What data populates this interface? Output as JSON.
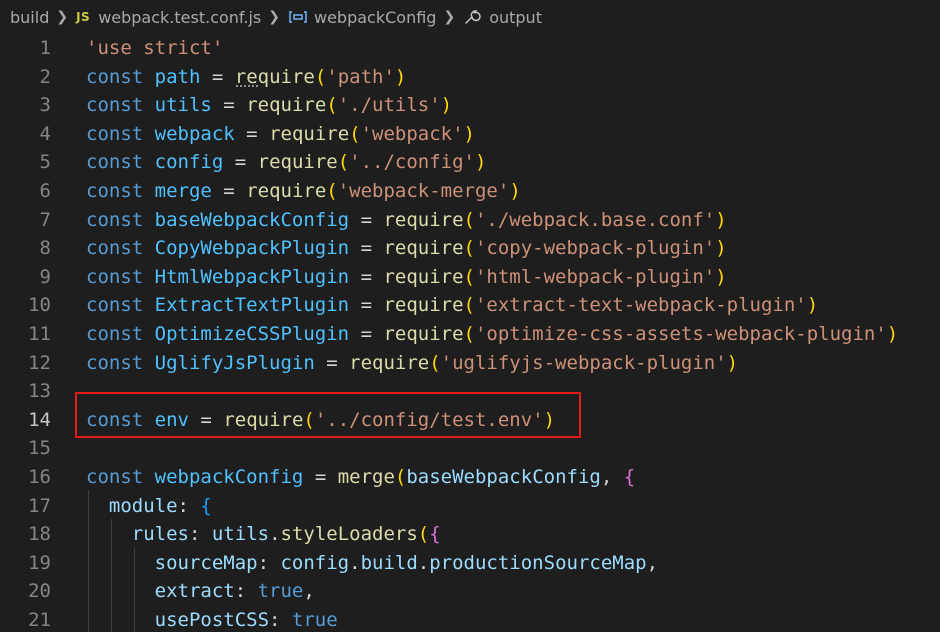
{
  "breadcrumb": {
    "folder": "build",
    "js_badge": "JS",
    "file": "webpack.test.conf.js",
    "symbol": "webpackConfig",
    "property": "output"
  },
  "code_lines": [
    {
      "n": "1",
      "tokens": [
        [
          "s",
          "'use strict'"
        ]
      ]
    },
    {
      "n": "2",
      "tokens": [
        [
          "k",
          "const"
        ],
        [
          "o",
          " "
        ],
        [
          "v",
          "path"
        ],
        [
          "o",
          " = "
        ],
        [
          "f",
          "require"
        ],
        [
          "br1",
          "("
        ],
        [
          "s",
          "'path'"
        ],
        [
          "br1",
          ")"
        ]
      ]
    },
    {
      "n": "3",
      "tokens": [
        [
          "k",
          "const"
        ],
        [
          "o",
          " "
        ],
        [
          "v",
          "utils"
        ],
        [
          "o",
          " = "
        ],
        [
          "f",
          "require"
        ],
        [
          "br1",
          "("
        ],
        [
          "s",
          "'./utils'"
        ],
        [
          "br1",
          ")"
        ]
      ]
    },
    {
      "n": "4",
      "tokens": [
        [
          "k",
          "const"
        ],
        [
          "o",
          " "
        ],
        [
          "v",
          "webpack"
        ],
        [
          "o",
          " = "
        ],
        [
          "f",
          "require"
        ],
        [
          "br1",
          "("
        ],
        [
          "s",
          "'webpack'"
        ],
        [
          "br1",
          ")"
        ]
      ]
    },
    {
      "n": "5",
      "tokens": [
        [
          "k",
          "const"
        ],
        [
          "o",
          " "
        ],
        [
          "v",
          "config"
        ],
        [
          "o",
          " = "
        ],
        [
          "f",
          "require"
        ],
        [
          "br1",
          "("
        ],
        [
          "s",
          "'../config'"
        ],
        [
          "br1",
          ")"
        ]
      ]
    },
    {
      "n": "6",
      "tokens": [
        [
          "k",
          "const"
        ],
        [
          "o",
          " "
        ],
        [
          "v",
          "merge"
        ],
        [
          "o",
          " = "
        ],
        [
          "f",
          "require"
        ],
        [
          "br1",
          "("
        ],
        [
          "s",
          "'webpack-merge'"
        ],
        [
          "br1",
          ")"
        ]
      ]
    },
    {
      "n": "7",
      "tokens": [
        [
          "k",
          "const"
        ],
        [
          "o",
          " "
        ],
        [
          "v",
          "baseWebpackConfig"
        ],
        [
          "o",
          " = "
        ],
        [
          "f",
          "require"
        ],
        [
          "br1",
          "("
        ],
        [
          "s",
          "'./webpack.base.conf'"
        ],
        [
          "br1",
          ")"
        ]
      ]
    },
    {
      "n": "8",
      "tokens": [
        [
          "k",
          "const"
        ],
        [
          "o",
          " "
        ],
        [
          "v",
          "CopyWebpackPlugin"
        ],
        [
          "o",
          " = "
        ],
        [
          "f",
          "require"
        ],
        [
          "br1",
          "("
        ],
        [
          "s",
          "'copy-webpack-plugin'"
        ],
        [
          "br1",
          ")"
        ]
      ]
    },
    {
      "n": "9",
      "tokens": [
        [
          "k",
          "const"
        ],
        [
          "o",
          " "
        ],
        [
          "v",
          "HtmlWebpackPlugin"
        ],
        [
          "o",
          " = "
        ],
        [
          "f",
          "require"
        ],
        [
          "br1",
          "("
        ],
        [
          "s",
          "'html-webpack-plugin'"
        ],
        [
          "br1",
          ")"
        ]
      ]
    },
    {
      "n": "10",
      "tokens": [
        [
          "k",
          "const"
        ],
        [
          "o",
          " "
        ],
        [
          "v",
          "ExtractTextPlugin"
        ],
        [
          "o",
          " = "
        ],
        [
          "f",
          "require"
        ],
        [
          "br1",
          "("
        ],
        [
          "s",
          "'extract-text-webpack-plugin'"
        ],
        [
          "br1",
          ")"
        ]
      ]
    },
    {
      "n": "11",
      "tokens": [
        [
          "k",
          "const"
        ],
        [
          "o",
          " "
        ],
        [
          "v",
          "OptimizeCSSPlugin"
        ],
        [
          "o",
          " = "
        ],
        [
          "f",
          "require"
        ],
        [
          "br1",
          "("
        ],
        [
          "s",
          "'optimize-css-assets-webpack-plugin'"
        ],
        [
          "br1",
          ")"
        ]
      ]
    },
    {
      "n": "12",
      "tokens": [
        [
          "k",
          "const"
        ],
        [
          "o",
          " "
        ],
        [
          "v",
          "UglifyJsPlugin"
        ],
        [
          "o",
          " = "
        ],
        [
          "f",
          "require"
        ],
        [
          "br1",
          "("
        ],
        [
          "s",
          "'uglifyjs-webpack-plugin'"
        ],
        [
          "br1",
          ")"
        ]
      ]
    },
    {
      "n": "13",
      "tokens": []
    },
    {
      "n": "14",
      "tokens": [
        [
          "k",
          "const"
        ],
        [
          "o",
          " "
        ],
        [
          "v",
          "env"
        ],
        [
          "o",
          " = "
        ],
        [
          "f",
          "require"
        ],
        [
          "br1",
          "("
        ],
        [
          "s",
          "'../config/test.env'"
        ],
        [
          "br1",
          ")"
        ]
      ]
    },
    {
      "n": "15",
      "tokens": []
    },
    {
      "n": "16",
      "tokens": [
        [
          "k",
          "const"
        ],
        [
          "o",
          " "
        ],
        [
          "v",
          "webpackConfig"
        ],
        [
          "o",
          " = "
        ],
        [
          "f",
          "merge"
        ],
        [
          "br1",
          "("
        ],
        [
          "prop",
          "baseWebpackConfig"
        ],
        [
          "o",
          ", "
        ],
        [
          "br2",
          "{"
        ]
      ]
    },
    {
      "n": "17",
      "tokens": [
        [
          "o",
          "  "
        ],
        [
          "prop",
          "module"
        ],
        [
          "o",
          ": "
        ],
        [
          "br3",
          "{"
        ]
      ]
    },
    {
      "n": "18",
      "tokens": [
        [
          "o",
          "    "
        ],
        [
          "prop",
          "rules"
        ],
        [
          "o",
          ": "
        ],
        [
          "prop",
          "utils"
        ],
        [
          "o",
          "."
        ],
        [
          "f",
          "styleLoaders"
        ],
        [
          "br1",
          "("
        ],
        [
          "br2",
          "{"
        ]
      ]
    },
    {
      "n": "19",
      "tokens": [
        [
          "o",
          "      "
        ],
        [
          "prop",
          "sourceMap"
        ],
        [
          "o",
          ": "
        ],
        [
          "prop",
          "config"
        ],
        [
          "o",
          "."
        ],
        [
          "prop",
          "build"
        ],
        [
          "o",
          "."
        ],
        [
          "prop",
          "productionSourceMap"
        ],
        [
          "o",
          ","
        ]
      ]
    },
    {
      "n": "20",
      "tokens": [
        [
          "o",
          "      "
        ],
        [
          "prop",
          "extract"
        ],
        [
          "o",
          ": "
        ],
        [
          "k",
          "true"
        ],
        [
          "o",
          ","
        ]
      ]
    },
    {
      "n": "21",
      "tokens": [
        [
          "o",
          "      "
        ],
        [
          "prop",
          "usePostCSS"
        ],
        [
          "o",
          ": "
        ],
        [
          "k",
          "true"
        ]
      ]
    }
  ],
  "colors": {
    "background": "#1e1e1e",
    "highlight_box": "#e51b1b"
  }
}
